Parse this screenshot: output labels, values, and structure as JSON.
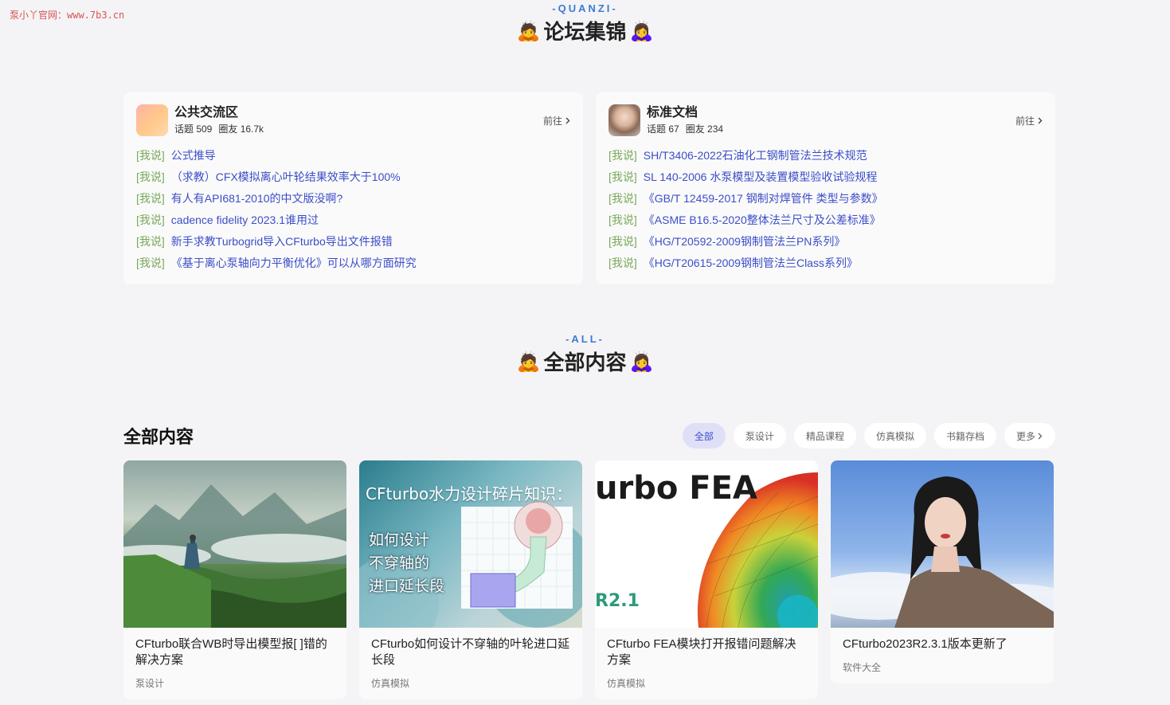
{
  "watermark": "泵小丫官网：www.7b3.cn",
  "quanzi_section": {
    "subtitle": "-QUANZI-",
    "title": "论坛集锦",
    "emoji_left": "🙇",
    "emoji_right": "🙇‍♀️"
  },
  "forums": [
    {
      "name": "公共交流区",
      "topics_label": "话题 509",
      "members_label": "圈友 16.7k",
      "go_label": "前往",
      "avatar_icon": "gradient-avatar",
      "posts": [
        {
          "tag": "[我说]",
          "title": "公式推导"
        },
        {
          "tag": "[我说]",
          "title": "（求教）CFX模拟离心叶轮结果效率大于100%"
        },
        {
          "tag": "[我说]",
          "title": "有人有API681-2010的中文版没啊?"
        },
        {
          "tag": "[我说]",
          "title": "cadence fidelity 2023.1谁用过"
        },
        {
          "tag": "[我说]",
          "title": "新手求教Turbogrid导入CFturbo导出文件报错"
        },
        {
          "tag": "[我说]",
          "title": "《基于离心泵轴向力平衡优化》可以从哪方面研究"
        }
      ]
    },
    {
      "name": "标准文档",
      "topics_label": "话题 67",
      "members_label": "圈友 234",
      "go_label": "前往",
      "avatar_icon": "portrait-avatar",
      "posts": [
        {
          "tag": "[我说]",
          "title": "SH/T3406-2022石油化工钢制管法兰技术规范"
        },
        {
          "tag": "[我说]",
          "title": "SL 140-2006 水泵模型及装置模型验收试验规程"
        },
        {
          "tag": "[我说]",
          "title": "《GB/T 12459-2017 钢制对焊管件 类型与参数》"
        },
        {
          "tag": "[我说]",
          "title": "《ASME B16.5-2020整体法兰尺寸及公差标准》"
        },
        {
          "tag": "[我说]",
          "title": "《HG/T20592-2009钢制管法兰PN系列》"
        },
        {
          "tag": "[我说]",
          "title": "《HG/T20615-2009钢制管法兰Class系列》"
        }
      ]
    }
  ],
  "all_section": {
    "subtitle": "-ALL-",
    "title": "全部内容",
    "emoji_left": "🙇",
    "emoji_right": "🙇‍♀️"
  },
  "content": {
    "heading": "全部内容",
    "tabs": [
      {
        "label": "全部",
        "active": true
      },
      {
        "label": "泵设计",
        "active": false
      },
      {
        "label": "精品课程",
        "active": false
      },
      {
        "label": "仿真模拟",
        "active": false
      },
      {
        "label": "书籍存档",
        "active": false
      },
      {
        "label": "更多",
        "active": false
      }
    ],
    "posts": [
      {
        "title": "CFturbo联合WB时导出模型报[ ]错的解决方案",
        "category": "泵设计",
        "thumb": "mountain-landscape-image"
      },
      {
        "title": "CFturbo如何设计不穿轴的叶轮进口延长段",
        "category": "仿真模拟",
        "thumb": "diagram-image",
        "thumb_text": {
          "headline": "CFturbo水力设计碎片知识：",
          "lines": [
            "如何设计",
            "不穿轴的",
            "进口延长段"
          ]
        }
      },
      {
        "title": "CFturbo FEA模块打开报错问题解决方案",
        "category": "仿真模拟",
        "thumb": "fea-mesh-image",
        "thumb_text": {
          "headline": "urbo FEA",
          "corner": "R2.1"
        }
      },
      {
        "title": "CFturbo2023R2.3.1版本更新了",
        "category": "软件大全",
        "thumb": "portrait-photo-image"
      }
    ]
  },
  "colors": {
    "accent_blue": "#3a7bd5",
    "link": "#3c4ec9",
    "tag_green": "#7aa85a",
    "active_tab_bg": "#dfe0f8"
  }
}
